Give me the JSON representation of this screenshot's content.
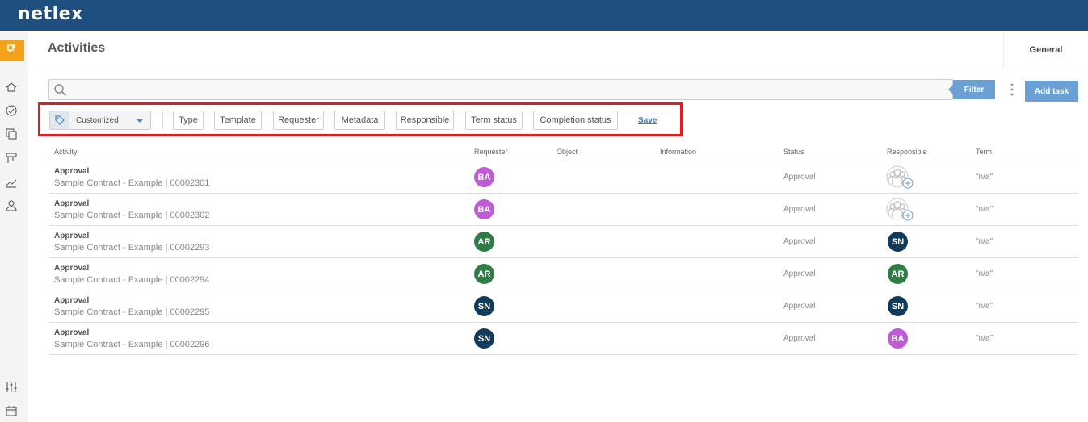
{
  "app": {
    "logo": "netlex"
  },
  "page": {
    "title": "Activities",
    "general_tab": "General"
  },
  "search": {
    "placeholder": ""
  },
  "toolbar": {
    "filter_label": "Filter",
    "add_task_label": "Add task"
  },
  "filters": {
    "view_select": "Customized",
    "chips": [
      "Type",
      "Template",
      "Requester",
      "Metadata",
      "Responsible",
      "Term status",
      "Completion status"
    ],
    "save_label": "Save"
  },
  "table": {
    "headers": [
      "Activity",
      "Requester",
      "Object",
      "Information",
      "Status",
      "Responsible",
      "Term"
    ],
    "rows": [
      {
        "title": "Approval",
        "subtitle": "Sample Contract - Example | 00002301",
        "requester": "BA",
        "status": "Approval",
        "responsible": "",
        "term": "\"n/a\""
      },
      {
        "title": "Approval",
        "subtitle": "Sample Contract - Example | 00002302",
        "requester": "BA",
        "status": "Approval",
        "responsible": "",
        "term": "\"n/a\""
      },
      {
        "title": "Approval",
        "subtitle": "Sample Contract - Example | 00002293",
        "requester": "AR",
        "status": "Approval",
        "responsible": "SN",
        "term": "\"n/a\""
      },
      {
        "title": "Approval",
        "subtitle": "Sample Contract - Example | 00002294",
        "requester": "AR",
        "status": "Approval",
        "responsible": "AR",
        "term": "\"n/a\""
      },
      {
        "title": "Approval",
        "subtitle": "Sample Contract - Example | 00002295",
        "requester": "SN",
        "status": "Approval",
        "responsible": "SN",
        "term": "\"n/a\""
      },
      {
        "title": "Approval",
        "subtitle": "Sample Contract - Example | 00002296",
        "requester": "SN",
        "status": "Approval",
        "responsible": "BA",
        "term": "\"n/a\""
      }
    ]
  },
  "colors": {
    "topbar": "#1e4f7e",
    "accent_orange": "#f5a21b",
    "button_blue": "#6aa0d4",
    "highlight_red": "#e11b22",
    "avatar_BA": "#c05ad6",
    "avatar_AR": "#2e7d45",
    "avatar_SN": "#123a5a"
  },
  "icons": {
    "sidebar": [
      "activities-icon",
      "home-icon",
      "dashboard-icon",
      "documents-icon",
      "kanban-icon",
      "analytics-icon",
      "user-icon",
      "settings-sliders-icon",
      "calendar-icon"
    ]
  }
}
